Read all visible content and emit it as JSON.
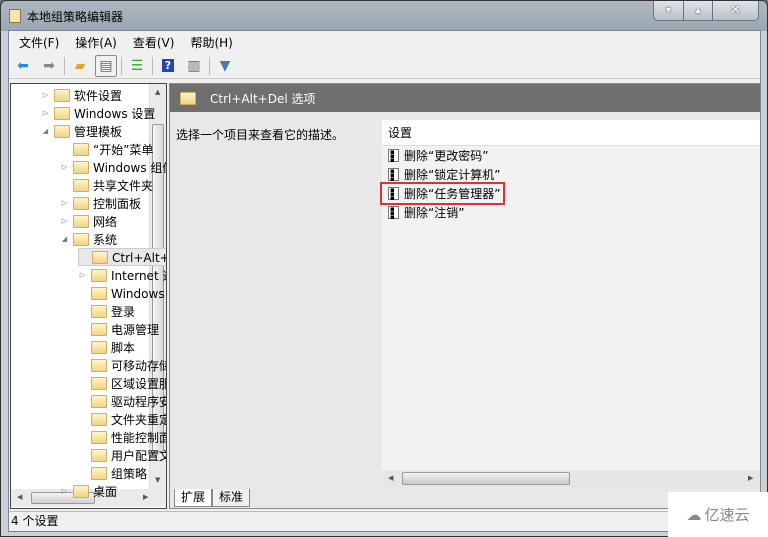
{
  "window": {
    "title": "本地组策略编辑器",
    "minimize": "▾",
    "maximize": "▴",
    "close": "✕"
  },
  "menu": [
    "文件(F)",
    "操作(A)",
    "查看(V)",
    "帮助(H)"
  ],
  "toolbar": [
    "back-icon",
    "forward-icon",
    "up-folder-icon",
    "show-hide-tree-icon",
    "export-list-icon",
    "help-icon",
    "show-action-pane-icon",
    "filter-icon"
  ],
  "tree": [
    {
      "label": "软件设置",
      "level": 1,
      "exp": "▷"
    },
    {
      "label": "Windows 设置",
      "level": 1,
      "exp": "▷"
    },
    {
      "label": "管理模板",
      "level": 1,
      "exp": "◢"
    },
    {
      "label": "“开始”菜单",
      "level": 2,
      "exp": ""
    },
    {
      "label": "Windows 组件",
      "level": 2,
      "exp": "▷"
    },
    {
      "label": "共享文件夹",
      "level": 2,
      "exp": ""
    },
    {
      "label": "控制面板",
      "level": 2,
      "exp": "▷"
    },
    {
      "label": "网络",
      "level": 2,
      "exp": "▷"
    },
    {
      "label": "系统",
      "level": 2,
      "exp": "◢"
    },
    {
      "label": "Ctrl+Alt+Del 选项",
      "level": 3,
      "exp": "",
      "selected": true
    },
    {
      "label": "Internet 通信管理",
      "level": 3,
      "exp": "▷"
    },
    {
      "label": "Windows 文件保护",
      "level": 3,
      "exp": ""
    },
    {
      "label": "登录",
      "level": 3,
      "exp": ""
    },
    {
      "label": "电源管理",
      "level": 3,
      "exp": ""
    },
    {
      "label": "脚本",
      "level": 3,
      "exp": ""
    },
    {
      "label": "可移动存储访问",
      "level": 3,
      "exp": ""
    },
    {
      "label": "区域设置服务",
      "level": 3,
      "exp": ""
    },
    {
      "label": "驱动程序安装",
      "level": 3,
      "exp": ""
    },
    {
      "label": "文件夹重定向",
      "level": 3,
      "exp": ""
    },
    {
      "label": "性能控制面板",
      "level": 3,
      "exp": ""
    },
    {
      "label": "用户配置文件",
      "level": 3,
      "exp": ""
    },
    {
      "label": "组策略",
      "level": 3,
      "exp": ""
    },
    {
      "label": "桌面",
      "level": 2,
      "exp": "▷"
    }
  ],
  "main": {
    "header": "Ctrl+Alt+Del 选项",
    "description": "选择一个项目来查看它的描述。",
    "column": "设置",
    "settings": [
      "删除“更改密码”",
      "删除“锁定计算机”",
      "删除“任务管理器”",
      "删除“注销”"
    ],
    "highlighted_index": 2,
    "highlight_color": "#e03030"
  },
  "tabs": [
    "扩展",
    "标准"
  ],
  "status": "4 个设置",
  "watermark": "亿速云"
}
